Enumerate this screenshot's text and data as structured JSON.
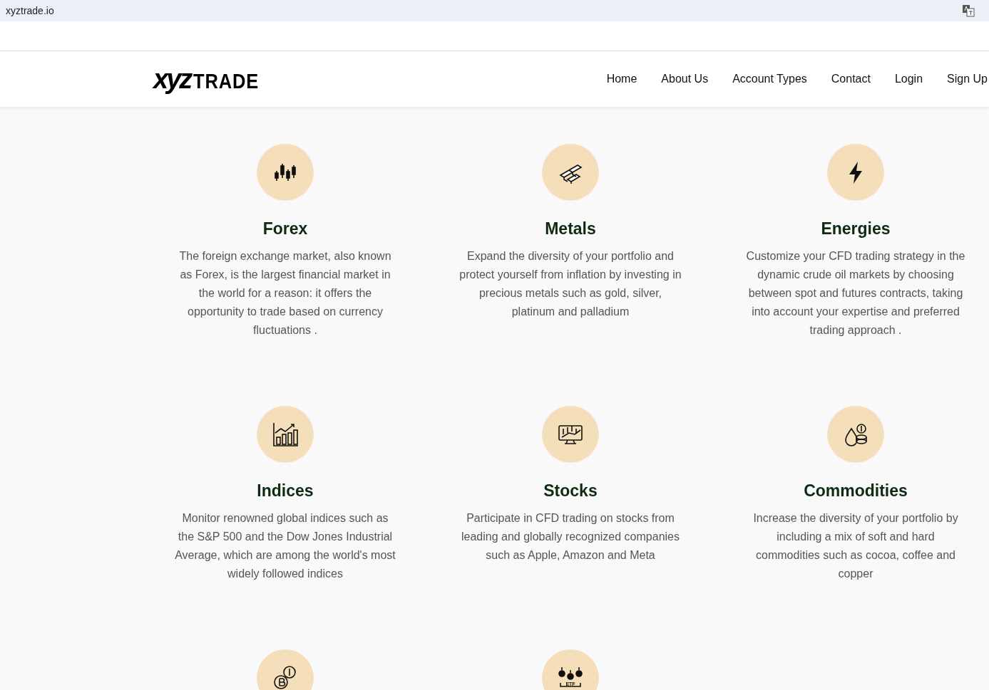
{
  "browser": {
    "address": "xyztrade.io"
  },
  "header": {
    "logo": {
      "mark": "xyz",
      "word": "TRADE"
    },
    "nav": [
      {
        "label": "Home"
      },
      {
        "label": "About Us"
      },
      {
        "label": "Account Types"
      },
      {
        "label": "Contact"
      },
      {
        "label": "Login"
      },
      {
        "label": "Sign Up"
      }
    ]
  },
  "markets": [
    {
      "title": "Forex",
      "text": "The foreign exchange market, also known as Forex, is the largest financial market in the world for a reason: it offers the opportunity to trade based on currency fluctuations ."
    },
    {
      "title": "Metals",
      "text": "Expand the diversity of your portfolio and protect yourself from inflation by investing in precious metals such as gold, silver, platinum and palladium"
    },
    {
      "title": "Energies",
      "text": "Customize your CFD trading strategy in the dynamic crude oil markets by choosing between spot and futures contracts, taking into account your expertise and preferred trading approach ."
    },
    {
      "title": "Indices",
      "text": "Monitor renowned global indices such as the S&P 500 and the Dow Jones Industrial Average, which are among the world's most widely followed indices"
    },
    {
      "title": "Stocks",
      "text": "Participate in CFD trading on stocks from leading and globally recognized companies such as Apple, Amazon and Meta"
    },
    {
      "title": "Commodities",
      "text": "Increase the diversity of your portfolio by including a mix of soft and hard commodities such as cocoa, coffee and copper"
    },
    {
      "kind": "crypto"
    },
    {
      "kind": "etf",
      "icon_label": "ETF"
    }
  ]
}
